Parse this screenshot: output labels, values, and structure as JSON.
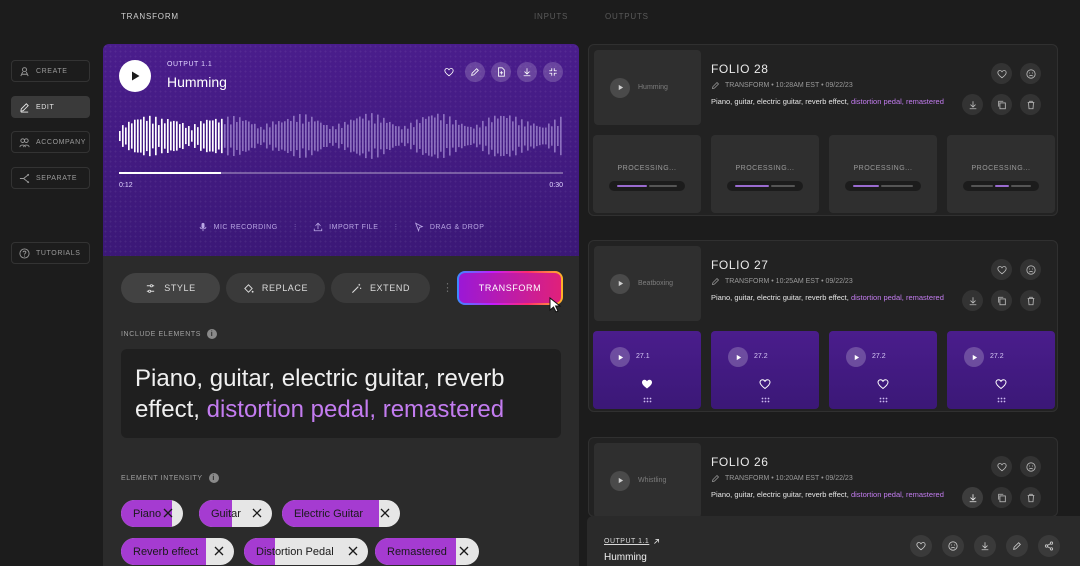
{
  "topbar": {
    "title": "TRANSFORM",
    "tab_inputs": "INPUTS",
    "tab_outputs": "OUTPUTS"
  },
  "sidebar": {
    "items": [
      {
        "label": "CREATE",
        "icon": "create-icon",
        "active": false
      },
      {
        "label": "EDIT",
        "icon": "pencil-icon",
        "active": true
      },
      {
        "label": "ACCOMPANY",
        "icon": "accompany-icon",
        "active": false
      },
      {
        "label": "SEPARATE",
        "icon": "separate-icon",
        "active": false
      }
    ],
    "tutorials_label": "TUTORIALS"
  },
  "player": {
    "output_label": "OUTPUT 1.1",
    "title": "Humming",
    "time_current": "0:12",
    "time_total": "0:30",
    "progress": 0.23,
    "sources": {
      "mic": "MIC RECORDING",
      "import": "IMPORT FILE",
      "drag": "DRAG & DROP"
    }
  },
  "modes": {
    "style": "STYLE",
    "replace": "REPLACE",
    "extend": "EXTEND",
    "transform": "TRANSFORM"
  },
  "include_elements": {
    "label": "INCLUDE ELEMENTS",
    "text_plain": "Piano, guitar, electric guitar, reverb effect, ",
    "text_highlight": "distortion pedal, remastered"
  },
  "element_intensity": {
    "label": "ELEMENT INTENSITY",
    "chips": [
      {
        "label": "Piano",
        "intensity": 0.82
      },
      {
        "label": "Guitar",
        "intensity": 0.45
      },
      {
        "label": "Electric Guitar",
        "intensity": 0.82
      },
      {
        "label": "Reverb effect",
        "intensity": 0.75
      },
      {
        "label": "Distortion Pedal",
        "intensity": 0.25
      },
      {
        "label": "Remastered",
        "intensity": 0.78
      }
    ]
  },
  "folios": [
    {
      "title": "FOLIO 28",
      "thumb_label": "Humming",
      "meta": "TRANSFORM • 10:28AM EST • 09/22/23",
      "desc_plain": "Piano, guitar, electric guitar, reverb effect, ",
      "desc_highlight": "distortion pedal, remastered",
      "processing_label": "PROCESSING..."
    },
    {
      "title": "FOLIO 27",
      "thumb_label": "Beatboxing",
      "meta": "TRANSFORM • 10:25AM EST • 09/22/23",
      "desc_plain": "Piano, guitar, electric guitar, reverb effect, ",
      "desc_highlight": "distortion pedal, remastered",
      "variants": [
        "27.1",
        "27.2",
        "27.2",
        "27.2"
      ]
    },
    {
      "title": "FOLIO 26",
      "thumb_label": "Whistling",
      "meta": "TRANSFORM • 10:20AM EST • 09/22/23",
      "desc_plain": "Piano, guitar, electric guitar, reverb effect, ",
      "desc_highlight": "distortion pedal, remastered"
    }
  ],
  "mini_player": {
    "output_label": "OUTPUT 1.1",
    "title": "Humming"
  },
  "colors": {
    "accent": "#a53bd1",
    "highlight_text": "#c37cf0",
    "player_bg": "#4a1d8c"
  }
}
